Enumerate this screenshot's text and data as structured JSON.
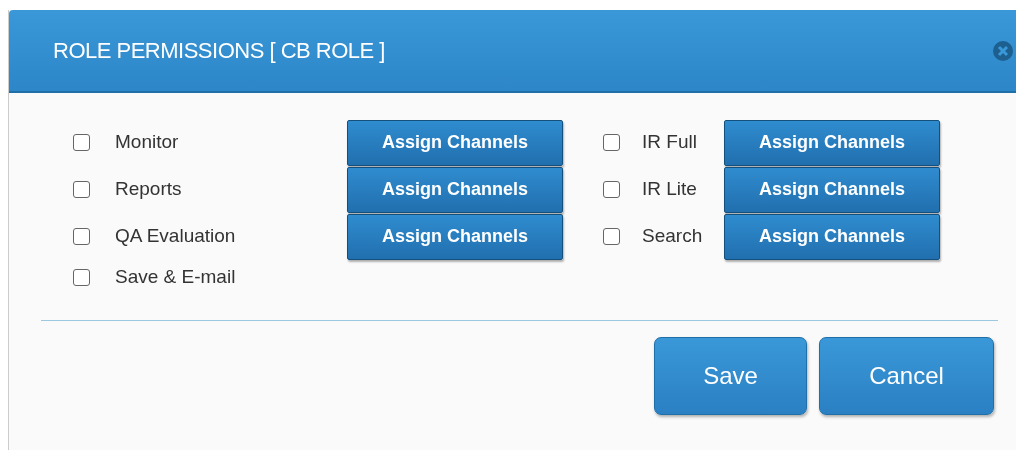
{
  "dialog": {
    "title": "ROLE PERMISSIONS [ CB ROLE ]"
  },
  "columns": [
    {
      "items": [
        {
          "label": "Monitor",
          "checked": false,
          "button": "Assign Channels"
        },
        {
          "label": "Reports",
          "checked": false,
          "button": "Assign Channels"
        },
        {
          "label": "QA Evaluation",
          "checked": false,
          "button": "Assign Channels"
        },
        {
          "label": "Save & E-mail",
          "checked": false
        }
      ]
    },
    {
      "items": [
        {
          "label": "IR Full",
          "checked": false,
          "button": "Assign Channels"
        },
        {
          "label": "IR Lite",
          "checked": false,
          "button": "Assign Channels"
        },
        {
          "label": "Search",
          "checked": false,
          "button": "Assign Channels"
        }
      ]
    }
  ],
  "buttons": [
    "Save",
    "Cancel"
  ]
}
